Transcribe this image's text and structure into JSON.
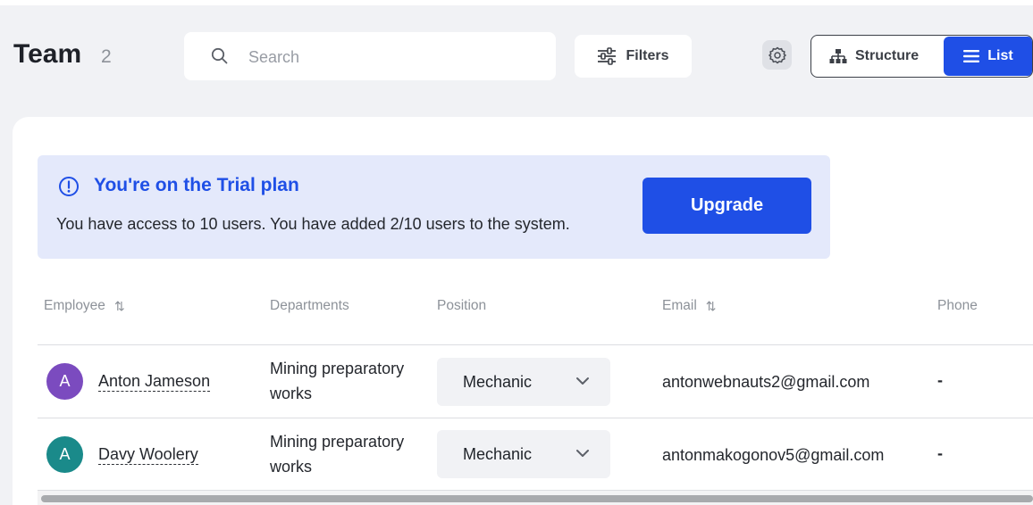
{
  "header": {
    "title": "Team",
    "count": "2",
    "search_placeholder": "Search",
    "filters_label": "Filters",
    "view_structure_label": "Structure",
    "view_list_label": "List",
    "active_view": "List"
  },
  "trial": {
    "title": "You're on the Trial plan",
    "message": "You have access to 10 users. You have added 2/10 users to the system.",
    "upgrade_label": "Upgrade"
  },
  "table": {
    "columns": [
      "Employee",
      "Departments",
      "Position",
      "Email",
      "Phone"
    ],
    "rows": [
      {
        "avatar_initial": "A",
        "name": "Anton Jameson",
        "department_line1": "Mining preparatory",
        "department_line2": "works",
        "position": "Mechanic",
        "email": "antonwebnauts2@gmail.com",
        "phone": "-"
      },
      {
        "avatar_initial": "A",
        "name": "Davy Woolery",
        "department_line1": "Mining preparatory",
        "department_line2": "works",
        "position": "Mechanic",
        "email": "antonmakogonov5@gmail.com",
        "phone": "-"
      }
    ]
  },
  "colors": {
    "accent": "#1f4fe6",
    "avatar_row1": "#7b4bbf",
    "avatar_row2": "#1a8a8a",
    "trial_bg": "#e4e9fb"
  },
  "icons": {
    "search": "search-icon",
    "filters": "sliders-icon",
    "settings": "gear-icon",
    "structure": "org-chart-icon",
    "list": "list-icon",
    "info": "info-icon",
    "sort": "sort-icon",
    "chevron": "chevron-down-icon"
  }
}
